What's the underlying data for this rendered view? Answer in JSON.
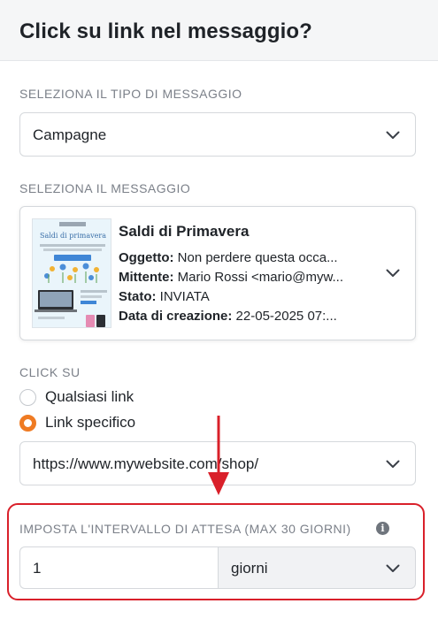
{
  "header": {
    "title": "Click su link nel messaggio?"
  },
  "message_type": {
    "label": "SELEZIONA IL TIPO DI MESSAGGIO",
    "selected": "Campagne"
  },
  "message": {
    "label": "SELEZIONA IL MESSAGGIO",
    "title": "Saldi di Primavera",
    "subject_key": "Oggetto:",
    "subject_val": " Non perdere questa occa...",
    "sender_key": "Mittente:",
    "sender_val": " Mario Rossi <mario@myw...",
    "status_key": "Stato:",
    "status_val": " INVIATA",
    "created_key": "Data di creazione:",
    "created_val": " 22-05-2025 07:...",
    "thumbnail": {
      "heading": "Saldi di primavera"
    }
  },
  "click_on": {
    "label": "CLICK SU",
    "options": [
      {
        "label": "Qualsiasi link",
        "checked": false
      },
      {
        "label": "Link specifico",
        "checked": true
      }
    ],
    "url": "https://www.mywebsite.com/shop/"
  },
  "wait_interval": {
    "label": "IMPOSTA L'INTERVALLO DI ATTESA (MAX 30 GIORNI)",
    "value": "1",
    "unit": "giorni"
  },
  "colors": {
    "accent": "#ef7b23",
    "highlight": "#d9202a"
  },
  "icons": {
    "dropdown": "chevron-down-icon",
    "info": "info-icon"
  }
}
